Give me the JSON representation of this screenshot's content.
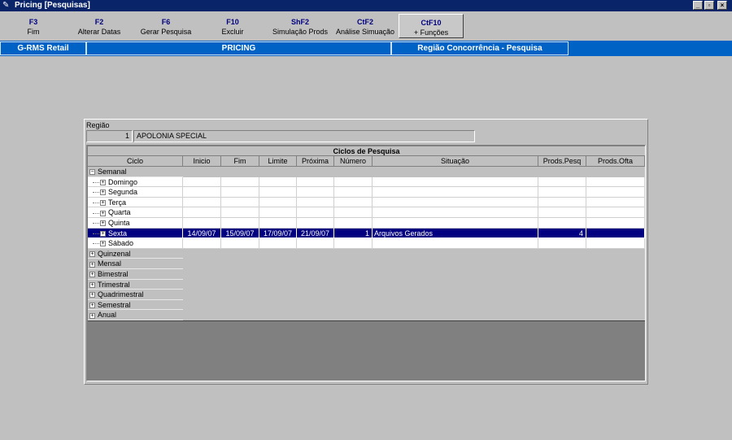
{
  "window": {
    "title": "Pricing [Pesquisas]",
    "controls": [
      "_",
      "▫",
      "×"
    ]
  },
  "toolbar": [
    {
      "key": "F3",
      "label": "Fim"
    },
    {
      "key": "F2",
      "label": "Alterar Datas"
    },
    {
      "key": "F6",
      "label": "Gerar Pesquisa"
    },
    {
      "key": "F10",
      "label": "Excluir"
    },
    {
      "key": "ShF2",
      "label": "Simulação Prods"
    },
    {
      "key": "CtF2",
      "label": "Análise Simuação"
    },
    {
      "key": "CtF10",
      "label": "+ Funções"
    }
  ],
  "nav": {
    "left": "G-RMS Retail",
    "center": "PRICING",
    "right": "Região Concorrência - Pesquisa"
  },
  "region": {
    "label": "Região",
    "code": "1",
    "name": "APOLONIA SPECIAL"
  },
  "grid": {
    "title": "Ciclos de Pesquisa",
    "columns": [
      "Ciclo",
      "Inicio",
      "Fim",
      "Limite",
      "Próxima",
      "Número",
      "Situação",
      "Prods.Pesq",
      "Prods.Ofta"
    ],
    "rows": [
      {
        "type": "group",
        "expander": "−",
        "ciclo": "Semanal"
      },
      {
        "type": "child",
        "expander": "+",
        "ciclo": "Domingo"
      },
      {
        "type": "child",
        "expander": "+",
        "ciclo": "Segunda"
      },
      {
        "type": "child",
        "expander": "+",
        "ciclo": "Terça"
      },
      {
        "type": "child",
        "expander": "+",
        "ciclo": "Quarta"
      },
      {
        "type": "child",
        "expander": "+",
        "ciclo": "Quinta"
      },
      {
        "type": "selected",
        "expander": "+",
        "ciclo": "Sexta",
        "inicio": "14/09/07",
        "fim": "15/09/07",
        "limite": "17/09/07",
        "proxima": "21/09/07",
        "numero": "1",
        "situacao": "Arquivos Gerados",
        "prods_pesq": "4",
        "prods_ofta": ""
      },
      {
        "type": "child",
        "expander": "+",
        "ciclo": "Sábado"
      },
      {
        "type": "group",
        "expander": "+",
        "ciclo": "Quinzenal"
      },
      {
        "type": "group",
        "expander": "+",
        "ciclo": "Mensal"
      },
      {
        "type": "group",
        "expander": "+",
        "ciclo": "Bimestral"
      },
      {
        "type": "group",
        "expander": "+",
        "ciclo": "Trimestral"
      },
      {
        "type": "group",
        "expander": "+",
        "ciclo": "Quadrimestral"
      },
      {
        "type": "group",
        "expander": "+",
        "ciclo": "Semestral"
      },
      {
        "type": "group",
        "expander": "+",
        "ciclo": "Anual"
      }
    ]
  }
}
